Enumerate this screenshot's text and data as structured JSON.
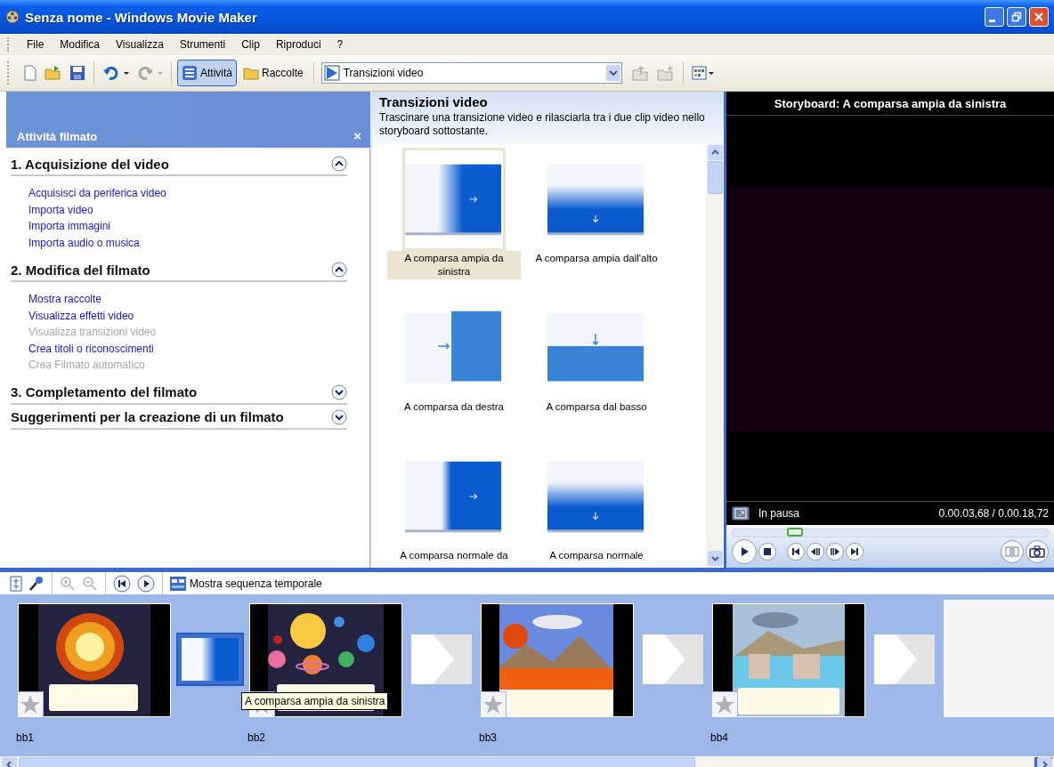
{
  "window": {
    "title": "Senza nome - Windows Movie Maker"
  },
  "menu": [
    "File",
    "Modifica",
    "Visualizza",
    "Strumenti",
    "Clip",
    "Riproduci",
    "?"
  ],
  "toolbar": {
    "panes": [
      {
        "label": "Attività",
        "selected": true
      },
      {
        "label": "Raccolte",
        "selected": false
      }
    ],
    "collection": "Transizioni video"
  },
  "task_pane": {
    "title": "Attività filmato",
    "close": "×",
    "sections": [
      {
        "title": "1. Acquisizione del video",
        "expanded": true,
        "links": [
          {
            "label": "Acquisisci da periferica video",
            "disabled": false
          },
          {
            "label": "Importa video",
            "disabled": false
          },
          {
            "label": "Importa immagini",
            "disabled": false
          },
          {
            "label": "Importa audio o musica",
            "disabled": false
          }
        ]
      },
      {
        "title": "2. Modifica del filmato",
        "expanded": true,
        "links": [
          {
            "label": "Mostra raccolte",
            "disabled": false
          },
          {
            "label": "Visualizza effetti video",
            "disabled": false
          },
          {
            "label": "Visualizza transizioni video",
            "disabled": true
          },
          {
            "label": "Crea titoli o riconoscimenti",
            "disabled": false
          },
          {
            "label": "Crea Filmato automatico",
            "disabled": true
          }
        ]
      },
      {
        "title": "3. Completamento del filmato",
        "expanded": false
      },
      {
        "title": "Suggerimenti per la creazione di un filmato",
        "expanded": false
      }
    ]
  },
  "transitions": {
    "title": "Transizioni video",
    "description": "Trascinare una transizione video e rilasciarla tra i due clip video nello storyboard sottostante.",
    "items": [
      {
        "label": "A comparsa ampia da sinistra",
        "kind": "wide_left",
        "selected": true
      },
      {
        "label": "A comparsa ampia dall'alto",
        "kind": "wide_top",
        "selected": false
      },
      {
        "label": "A comparsa da destra",
        "kind": "from_right",
        "selected": false
      },
      {
        "label": "A comparsa dal basso",
        "kind": "from_bottom",
        "selected": false
      },
      {
        "label": "A comparsa normale da",
        "kind": "normal_left",
        "selected": false
      },
      {
        "label": "A comparsa normale",
        "kind": "normal_top",
        "selected": false
      }
    ]
  },
  "preview": {
    "title": "Storyboard: A comparsa ampia da sinistra",
    "status": "In pausa",
    "time": "0.00.03,68 / 0.00.18,72",
    "level": 0.2
  },
  "storyboard_toolbar": {
    "timeline_button": "Mostra sequenza temporale"
  },
  "storyboard": {
    "tooltip": "A comparsa ampia da sinistra",
    "items": [
      {
        "kind": "clip",
        "label": "bb1",
        "selected": false
      },
      {
        "kind": "transition",
        "selected": true
      },
      {
        "kind": "clip",
        "label": "bb2",
        "selected": false
      },
      {
        "kind": "slot"
      },
      {
        "kind": "clip",
        "label": "bb3",
        "selected": false
      },
      {
        "kind": "slot"
      },
      {
        "kind": "clip",
        "label": "bb4",
        "selected": false
      },
      {
        "kind": "slot"
      },
      {
        "kind": "empty"
      }
    ]
  }
}
